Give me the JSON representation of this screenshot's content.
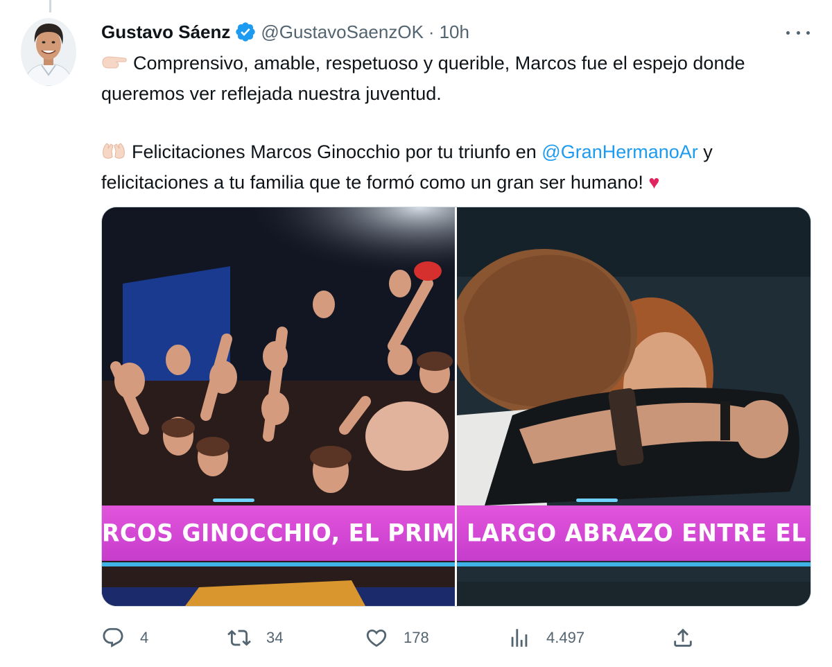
{
  "tweet": {
    "author_name": "Gustavo Sáenz",
    "handle": "@GustavoSaenzOK",
    "separator": "·",
    "time": "10h",
    "paragraph1": "Comprensivo, amable, respetuoso y querible, Marcos fue el espejo donde queremos ver reflejada nuestra juventud.",
    "paragraph2_start": "Felicitaciones Marcos Ginocchio por tu triunfo en ",
    "mention": "@GranHermanoAr",
    "paragraph2_end": " y felicitaciones a tu familia que te formó como un gran ser humano! ",
    "heart": "♥",
    "emoji1": "pointing-right-emoji",
    "emoji2": "clapping-hands-emoji"
  },
  "media": {
    "left_banner": "RCOS GINOCCHIO, EL PRIMO, ES EL GANA",
    "right_banner": "LARGO ABRAZO ENTRE EL PRIMO Y M"
  },
  "actions": {
    "replies": "4",
    "retweets": "34",
    "likes": "178",
    "views": "4.497"
  },
  "colors": {
    "link": "#1d9bf0",
    "secondary_text": "#536471",
    "verified": "#1d9bf0",
    "banner": "#d84ad6"
  }
}
